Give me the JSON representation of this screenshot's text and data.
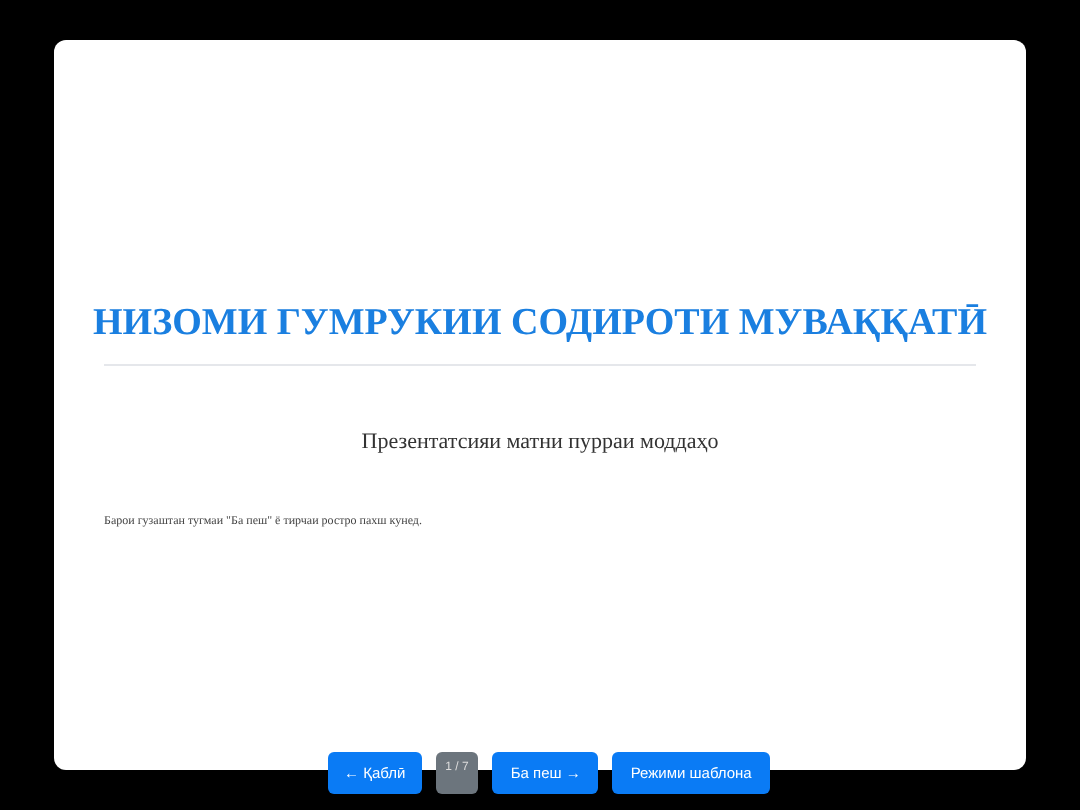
{
  "slide": {
    "title": "НИЗОМИ ГУМРУКИИ СОДИРОТИ МУВАҚҚАТӢ",
    "subtitle": "Презентатсияи матни пурраи моддаҳо",
    "note": "Барои гузаштан тугмаи \"Ба пеш\" ё тирчаи ростро пахш кунед."
  },
  "nav": {
    "prev": "← Қаблӣ",
    "counter": "1 / 7",
    "next": "Ба пеш →",
    "template": "Режими шаблона"
  }
}
